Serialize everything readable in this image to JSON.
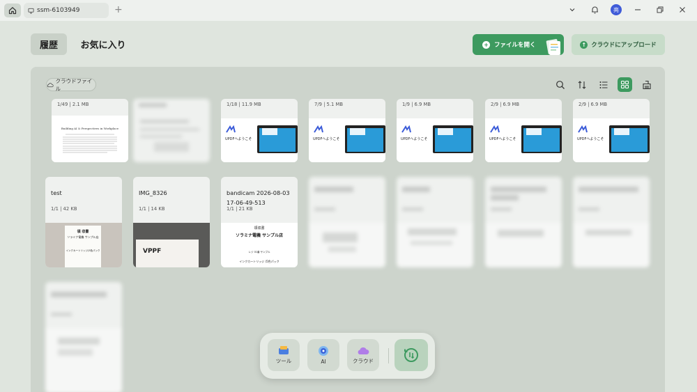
{
  "titlebar": {
    "tab_label": "ssm-6103949",
    "avatar_label": "亮"
  },
  "nav": {
    "history": "履歴",
    "favorites": "お気に入り"
  },
  "actions": {
    "open_file": "ファイルを開く",
    "cloud_upload": "クラウドにアップロード"
  },
  "panel": {
    "cloud_files": "クラウドファイル"
  },
  "row1": [
    {
      "meta": "1/49 | 2.1 MB",
      "thumb": "paper"
    },
    {
      "meta": "",
      "thumb": "blur"
    },
    {
      "meta": "1/18 | 11.9 MB",
      "thumb": "updf"
    },
    {
      "meta": "7/9 | 5.1 MB",
      "thumb": "updf"
    },
    {
      "meta": "1/9 | 6.9 MB",
      "thumb": "updf"
    },
    {
      "meta": "2/9 | 6.9 MB",
      "thumb": "updf"
    },
    {
      "meta": "2/9 | 6.9 MB",
      "thumb": "updf"
    }
  ],
  "row2": [
    {
      "name": "test",
      "meta": "1/1 | 42 KB",
      "thumb": "receipt"
    },
    {
      "name": "IMG_8326",
      "meta": "1/1 | 14 KB",
      "thumb": "photo"
    },
    {
      "name": "bandicam 2026-08-03 17-06-49-513",
      "meta": "1/1 | 21 KB",
      "thumb": "receipt2"
    },
    {
      "name": "",
      "meta": "",
      "thumb": "blur"
    },
    {
      "name": "",
      "meta": "",
      "thumb": "blur"
    },
    {
      "name": "",
      "meta": "",
      "thumb": "blur"
    },
    {
      "name": "",
      "meta": "",
      "thumb": "blur"
    }
  ],
  "thumb_text": {
    "paper_title": "Building AI & Perspectives in Workplace",
    "updf_title": "UPDFへようこそ",
    "receipt_title": "領 収書",
    "receipt_store": "ソラミナ電機 サンプル店",
    "receipt_item": "インクカートリッジ(5色パック",
    "receipt2_title": "領収書",
    "receipt2_store": "ソラミナ電機 サンプル店",
    "receipt2_line": "レジ 01番 サンプル",
    "receipt2_item": "インクカートリッジ (5色パック",
    "photo_text": "VPPF"
  },
  "dock": {
    "tools": "ツール",
    "ai": "AI",
    "cloud": "クラウド"
  },
  "colors": {
    "accent": "#3d9a5f",
    "panel": "#cdd4cc",
    "bg": "#dfe5de"
  }
}
